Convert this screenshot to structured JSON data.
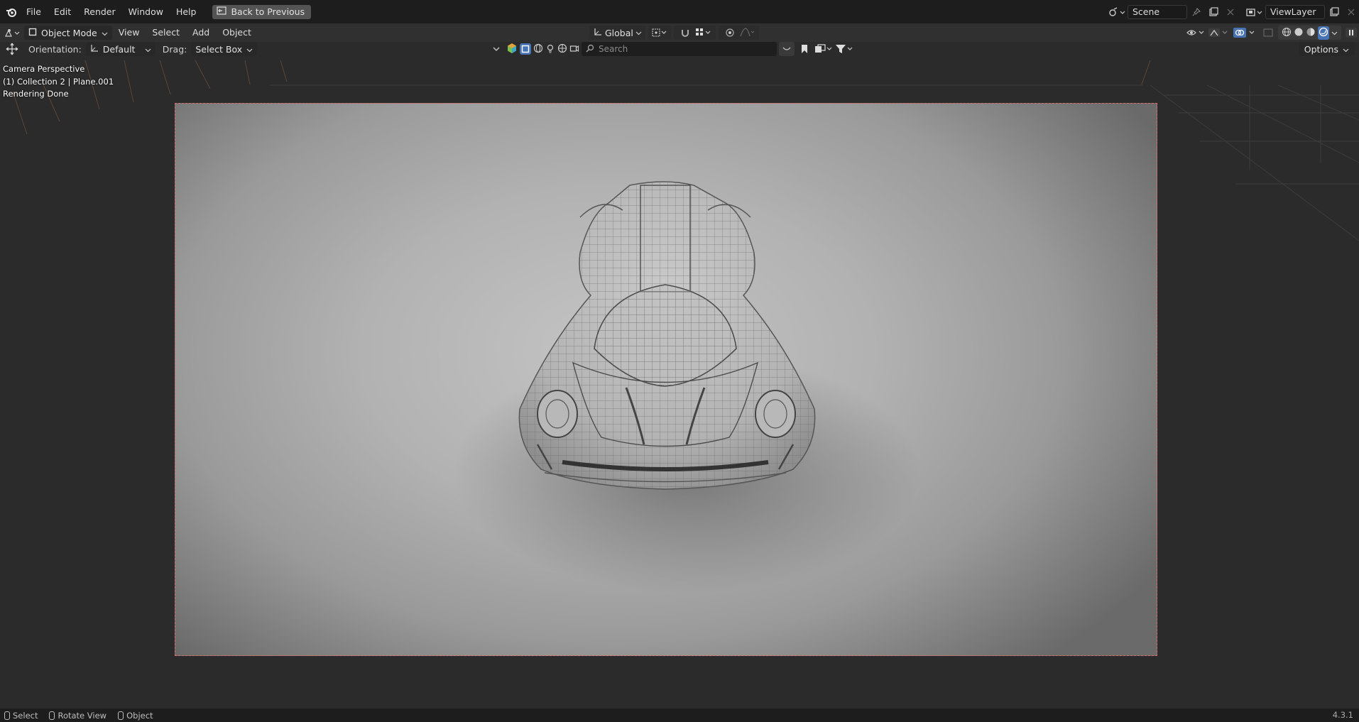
{
  "menu": {
    "file": "File",
    "edit": "Edit",
    "render": "Render",
    "window": "Window",
    "help": "Help",
    "back_button": "Back to Previous"
  },
  "scene": {
    "name": "Scene",
    "view_layer": "ViewLayer"
  },
  "viewport_header": {
    "mode": "Object Mode",
    "view": "View",
    "select": "Select",
    "add": "Add",
    "object": "Object",
    "transform_orientation": "Global"
  },
  "tool_settings": {
    "orientation_label": "Orientation:",
    "orientation_value": "Default",
    "drag_label": "Drag:",
    "drag_value": "Select Box",
    "search_placeholder": "Search",
    "options": "Options"
  },
  "overlay": {
    "line1": "Camera Perspective",
    "line2": "(1) Collection 2 | Plane.001",
    "line3": "Rendering Done"
  },
  "status_bar": {
    "select": "Select",
    "rotate": "Rotate View",
    "object": "Object",
    "version": "4.3.1"
  },
  "colors": {
    "camera_frame_border": "#d86a6a",
    "accent_blue": "#4772b3",
    "topbar_bg": "#1d1d1d",
    "header_bg": "#303030"
  }
}
